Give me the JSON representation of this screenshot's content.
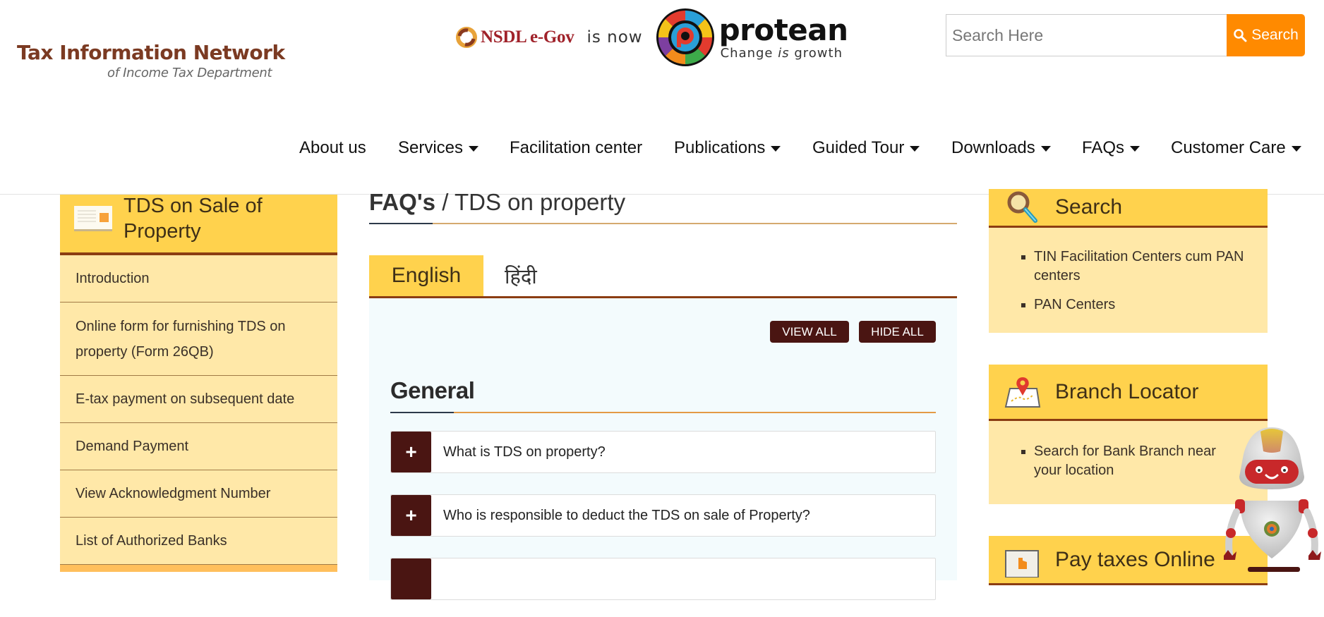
{
  "header": {
    "logo": {
      "line1": "Tax Information Network",
      "line2": "of Income Tax Department"
    },
    "brand": {
      "old_name": "NSDL e-Gov",
      "connector": "is now",
      "new_name": "protean",
      "tagline_pre": "Change ",
      "tagline_em": "is",
      "tagline_post": " growth"
    },
    "search": {
      "placeholder": "Search Here",
      "value": "",
      "button_label": "Search",
      "button_color": "#ff8a00"
    }
  },
  "nav": {
    "items": [
      {
        "label": "About us",
        "has_dropdown": false
      },
      {
        "label": "Services",
        "has_dropdown": true
      },
      {
        "label": "Facilitation center",
        "has_dropdown": false
      },
      {
        "label": "Publications",
        "has_dropdown": true
      },
      {
        "label": "Guided Tour",
        "has_dropdown": true
      },
      {
        "label": "Downloads",
        "has_dropdown": true
      },
      {
        "label": "FAQs",
        "has_dropdown": true
      },
      {
        "label": "Customer Care",
        "has_dropdown": true
      }
    ]
  },
  "left_sidebar": {
    "title": "TDS on Sale of Property",
    "icon": "card-icon",
    "items": [
      {
        "label": "Introduction"
      },
      {
        "label": "Online form for furnishing TDS on property (Form 26QB)"
      },
      {
        "label": "E-tax payment on subsequent date"
      },
      {
        "label": "Demand Payment"
      },
      {
        "label": "View Acknowledgment Number"
      },
      {
        "label": "List of Authorized Banks"
      }
    ]
  },
  "main": {
    "breadcrumb": {
      "root": "FAQ's",
      "separator": " / ",
      "current": "TDS on property"
    },
    "tabs": [
      {
        "label": "English",
        "active": true
      },
      {
        "label": "हिंदी",
        "active": false
      }
    ],
    "buttons": {
      "view_all": "VIEW ALL",
      "hide_all": "HIDE ALL"
    },
    "section_title": "General",
    "faqs": [
      {
        "toggle": "+",
        "question": "What is TDS on property?"
      },
      {
        "toggle": "+",
        "question": "Who is responsible to deduct the TDS on sale of Property?"
      },
      {
        "toggle": "+",
        "question": ""
      }
    ]
  },
  "right_sidebar": {
    "widgets": [
      {
        "title": "Search",
        "icon": "magnifier-icon",
        "items": [
          "TIN Facilitation Centers cum PAN centers",
          "PAN Centers"
        ]
      },
      {
        "title": "Branch Locator",
        "icon": "map-pin-icon",
        "items": [
          "Search for Bank Branch near your location"
        ]
      },
      {
        "title": "Pay taxes Online",
        "icon": "hand-pointer-icon",
        "items": []
      }
    ]
  },
  "colors": {
    "accent_yellow": "#ffd24d",
    "light_yellow": "#ffe8a8",
    "brown_border": "#8b3d12",
    "dark_maroon": "#4a1512",
    "search_orange": "#ff8a00",
    "panel_bg": "#f3fbfd"
  }
}
